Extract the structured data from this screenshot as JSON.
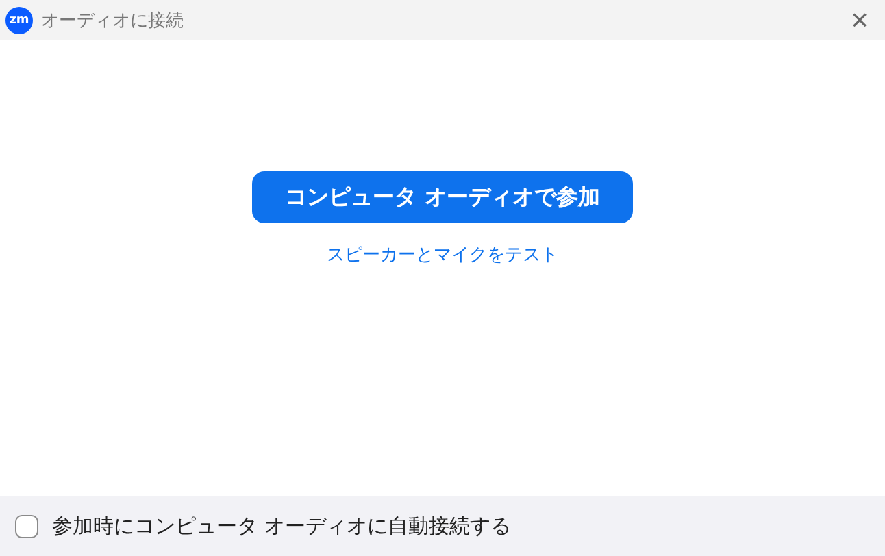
{
  "window": {
    "logo": "zm",
    "title": "オーディオに接続",
    "close": "×"
  },
  "join_button": {
    "label": "コンピュータ オーディオで参加"
  },
  "test_link": {
    "label": "スピーカーとマイクをテスト"
  },
  "footer": {
    "auto_connect": {
      "label": "参加時にコンピュータ オーディオに自動接続する",
      "checked": false
    }
  }
}
